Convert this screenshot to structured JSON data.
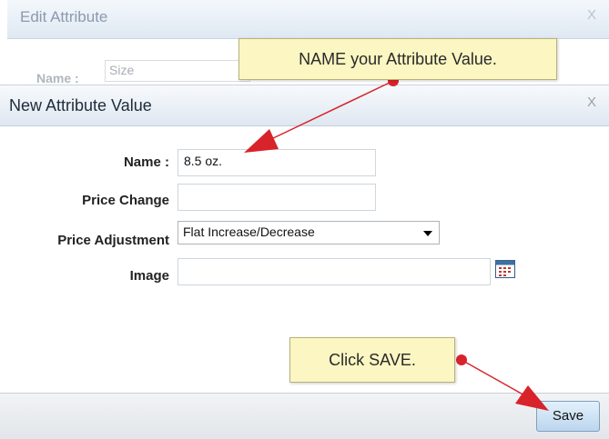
{
  "background_dialog": {
    "title": "Edit Attribute",
    "close_glyph": "X",
    "name_label": "Name :",
    "name_value": "Size"
  },
  "dialog": {
    "title": "New Attribute Value",
    "close_glyph": "X",
    "fields": {
      "name": {
        "label": "Name :",
        "value": "8.5 oz."
      },
      "price_change": {
        "label": "Price Change",
        "value": ""
      },
      "price_adjustment": {
        "label": "Price Adjustment",
        "selected": "Flat Increase/Decrease"
      },
      "image": {
        "label": "Image",
        "value": ""
      }
    },
    "save_label": "Save"
  },
  "annotations": {
    "callout_name": "NAME your Attribute Value.",
    "callout_save": "Click SAVE.",
    "arrow_color": "#d8232a",
    "callout_bg": "#fbf6c2"
  }
}
